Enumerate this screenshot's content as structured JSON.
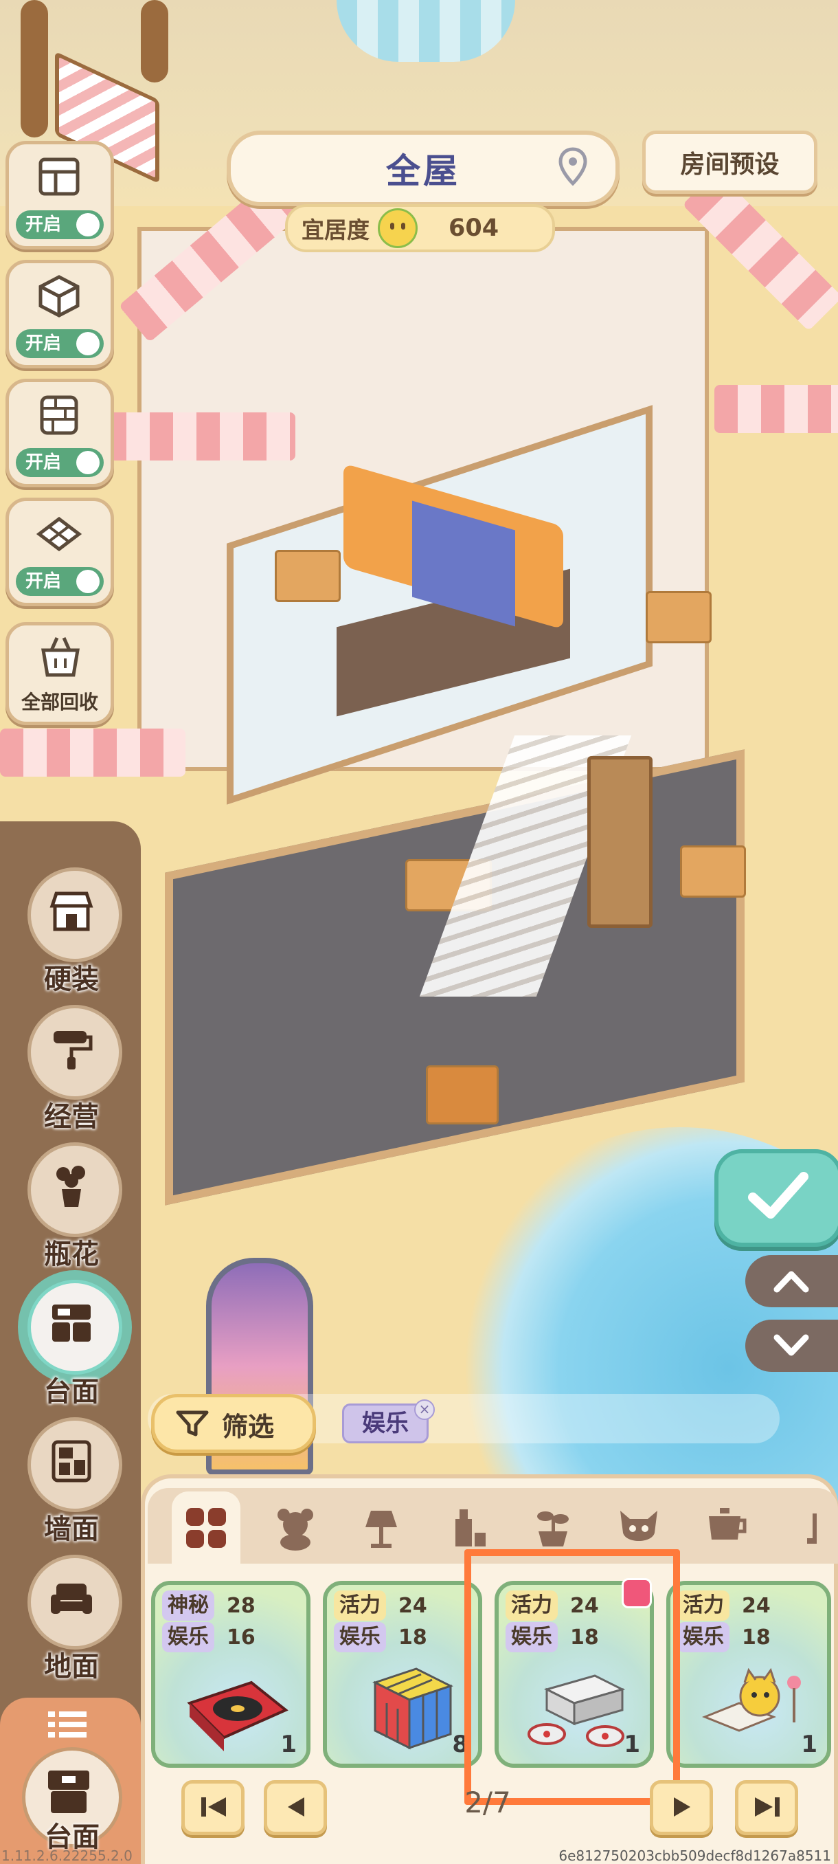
{
  "header": {
    "room_title": "全屋",
    "preset_button": "房间预设",
    "comfort_label": "宜居度",
    "comfort_value": "604"
  },
  "toggles": [
    {
      "icon": "roof-icon",
      "label": "开启"
    },
    {
      "icon": "wall-cube-icon",
      "label": "开启"
    },
    {
      "icon": "brick-wall-icon",
      "label": "开启"
    },
    {
      "icon": "floor-tile-icon",
      "label": "开启"
    }
  ],
  "recycle_all": {
    "icon": "basket-icon",
    "label": "全部回收"
  },
  "categories": [
    {
      "icon": "storefront-icon",
      "label": "硬装"
    },
    {
      "icon": "paint-roller-icon",
      "label": "经营"
    },
    {
      "icon": "flower-vase-icon",
      "label": "瓶花"
    },
    {
      "icon": "tabletop-icon",
      "label": "台面",
      "active": true
    },
    {
      "icon": "wall-item-icon",
      "label": "墙面"
    },
    {
      "icon": "sofa-icon",
      "label": "地面"
    }
  ],
  "bottom_tab": {
    "icon": "cabinet-icon",
    "label": "台面"
  },
  "filter": {
    "button_label": "筛选",
    "active_tag": "娱乐"
  },
  "item_tabs": [
    "grid-icon",
    "bear-icon",
    "lamp-icon",
    "bottle-icon",
    "plant-icon",
    "mask-icon",
    "teapot-icon",
    "partial-icon"
  ],
  "items": [
    {
      "name": "record-player",
      "stats": [
        {
          "k": "神秘",
          "v": "28",
          "color": "purple"
        },
        {
          "k": "娱乐",
          "v": "16",
          "color": "purple"
        }
      ],
      "count": "1"
    },
    {
      "name": "rubiks-cube",
      "stats": [
        {
          "k": "活力",
          "v": "24",
          "color": "yellow"
        },
        {
          "k": "娱乐",
          "v": "18",
          "color": "purple"
        }
      ],
      "count": "8"
    },
    {
      "name": "game-console",
      "stats": [
        {
          "k": "活力",
          "v": "24",
          "color": "yellow"
        },
        {
          "k": "娱乐",
          "v": "18",
          "color": "purple"
        }
      ],
      "count": "1",
      "new": true
    },
    {
      "name": "cat-storybook",
      "stats": [
        {
          "k": "活力",
          "v": "24",
          "color": "yellow"
        },
        {
          "k": "娱乐",
          "v": "18",
          "color": "purple"
        }
      ],
      "count": "1"
    }
  ],
  "pagination": {
    "indicator": "2/7"
  },
  "footer": {
    "version": "1.11.2.6.22255.2.0",
    "hash": "6e812750203cbb509decf8d1267a8511"
  },
  "colors": {
    "accent": "#79d3c5",
    "highlight": "#ff7a3b",
    "rail": "#85644a"
  }
}
